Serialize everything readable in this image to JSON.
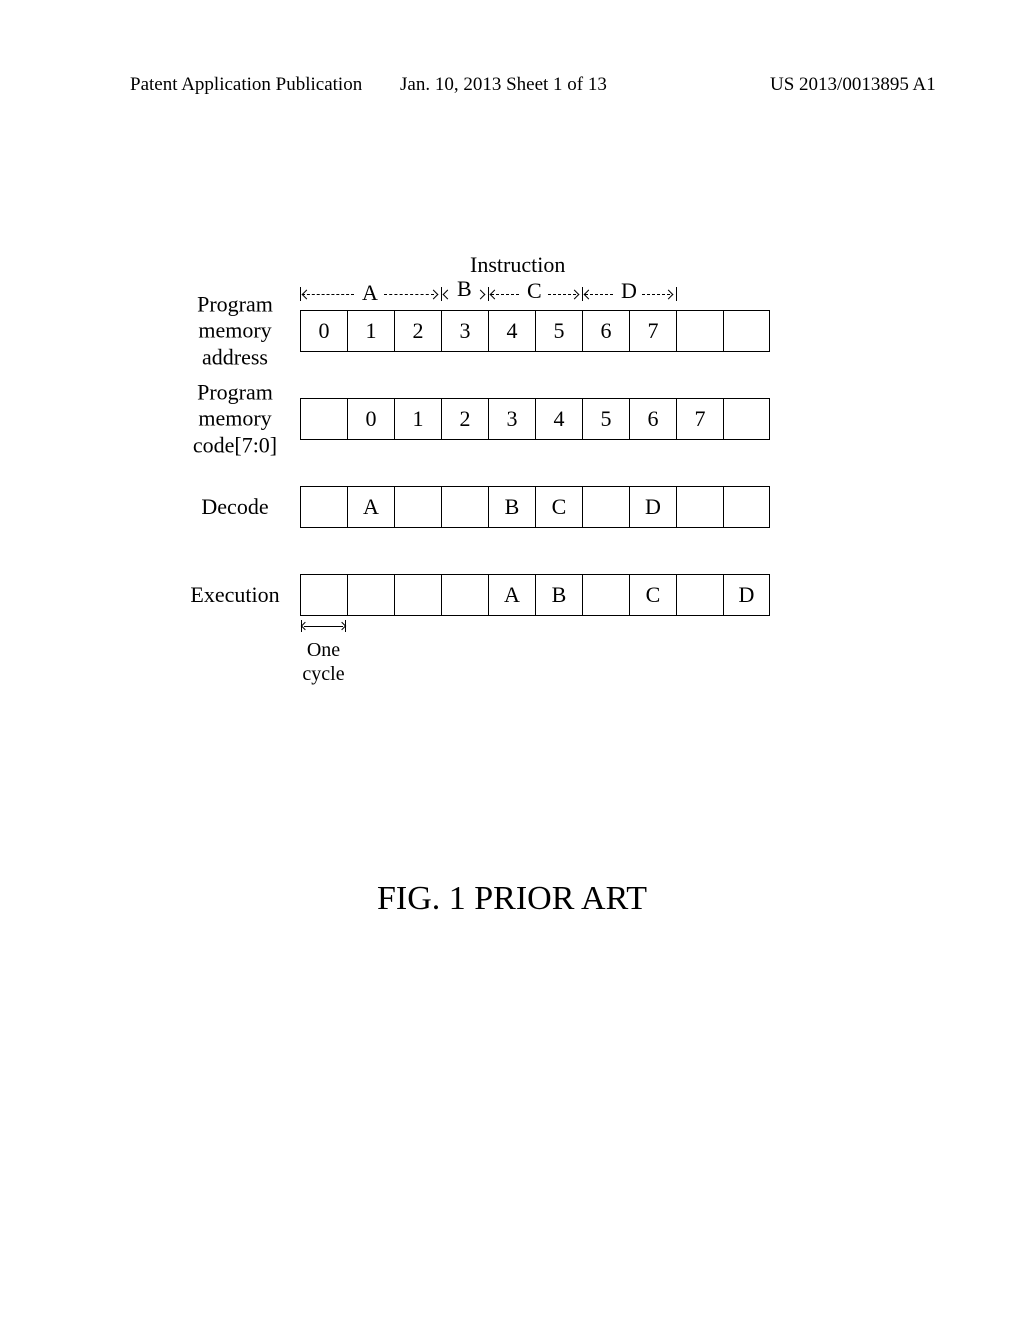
{
  "header": {
    "left": "Patent Application Publication",
    "center": "Jan. 10, 2013  Sheet 1 of 13",
    "right": "US 2013/0013895 A1"
  },
  "diagram": {
    "instruction_label": "Instruction",
    "span_letters": {
      "A": "A",
      "B": "B",
      "C": "C",
      "D": "D"
    },
    "rows": {
      "pma": {
        "label": "Program\nmemory\naddress",
        "cells": [
          "0",
          "1",
          "2",
          "3",
          "4",
          "5",
          "6",
          "7",
          "",
          ""
        ]
      },
      "pmc": {
        "label": "Program\nmemory\ncode[7:0]",
        "cells": [
          "",
          "0",
          "1",
          "2",
          "3",
          "4",
          "5",
          "6",
          "7",
          ""
        ]
      },
      "decode": {
        "label": "Decode",
        "cells": [
          "",
          "A",
          "",
          "",
          "B",
          "C",
          "",
          "D",
          "",
          ""
        ]
      },
      "exec": {
        "label": "Execution",
        "cells": [
          "",
          "",
          "",
          "",
          "A",
          "B",
          "",
          "C",
          "",
          "D"
        ]
      }
    },
    "cycle_label": "One\ncycle"
  },
  "caption": "FIG. 1 PRIOR ART"
}
